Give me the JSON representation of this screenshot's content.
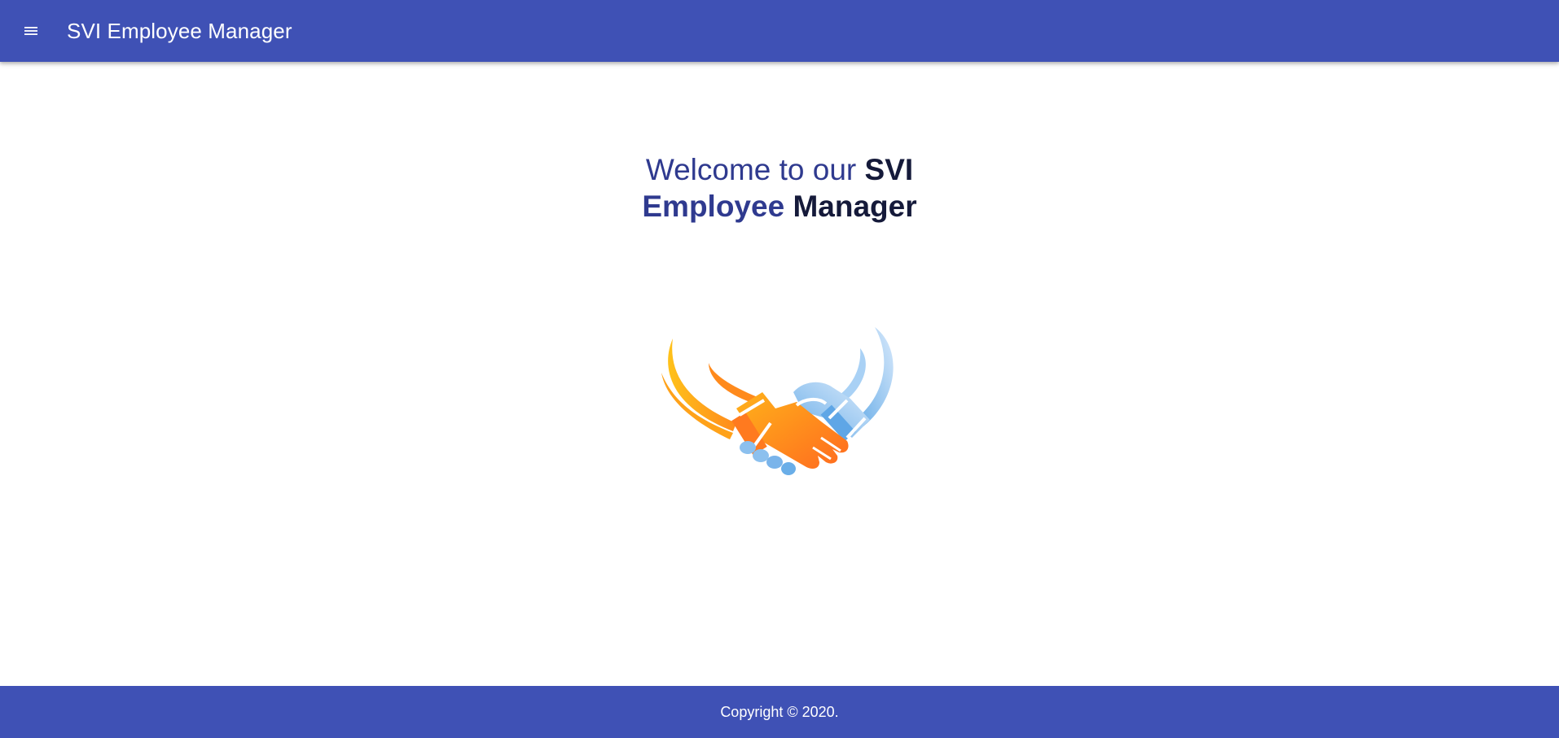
{
  "toolbar": {
    "menu_icon": "menu-icon",
    "title": "SVI Employee Manager"
  },
  "welcome": {
    "part1": "Welcome to our ",
    "part2": "SVI",
    "part3": "Employee",
    "part4": " Manager"
  },
  "logo": {
    "icon": "handshake-icon"
  },
  "footer": {
    "copyright": "Copyright © 2020."
  },
  "colors": {
    "primary": "#3f51b5",
    "heading_blue": "#2f3a8f",
    "heading_dark": "#151a3a",
    "orange": "#ff8a1c",
    "light_blue": "#9cc8f0"
  }
}
